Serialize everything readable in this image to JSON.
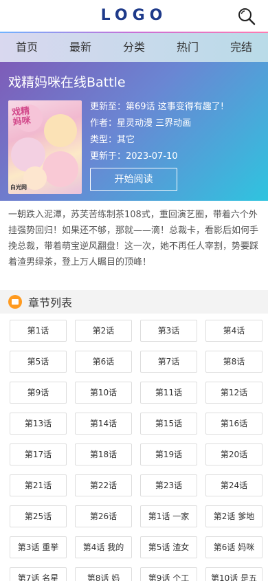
{
  "header": {
    "logo": "LOGO"
  },
  "nav": [
    "首页",
    "最新",
    "分类",
    "热门",
    "完结"
  ],
  "comic": {
    "title": "戏精妈咪在线Battle",
    "update_label": "更新至：",
    "update_value": "第69话 这事变得有趣了!",
    "author_label": "作者：",
    "author_value": "星灵动漫 三界动画",
    "type_label": "类型：",
    "type_value": "其它",
    "date_label": "更新于：",
    "date_value": "2023-07-10",
    "start_label": "开始阅读",
    "cover_logo": "白光网"
  },
  "description": "一朝跌入泥潭，苏芙苦练制茶108式，重回演艺圈，带着六个外挂强势回归！如果还不够，那就——滴！总裁卡，看影后如何手挽总裁，带着萌宝逆风翻盘！这一次，她不再任人宰割，势要踩着渣男绿茶，登上万人瞩目的顶峰！",
  "chapters_title": "章节列表",
  "chapters": [
    "第1话",
    "第2话",
    "第3话",
    "第4话",
    "第5话",
    "第6话",
    "第7话",
    "第8话",
    "第9话",
    "第10话",
    "第11话",
    "第12话",
    "第13话",
    "第14话",
    "第15话",
    "第16话",
    "第17话",
    "第18话",
    "第19话",
    "第20话",
    "第21话",
    "第22话",
    "第23话",
    "第24话",
    "第25话",
    "第26话",
    "第1话 一家",
    "第2话 爹地",
    "第3话 重挙",
    "第4话 我的",
    "第5话 渣女",
    "第6话 妈咪",
    "第7话 名星",
    "第8话 妈",
    "第9话 个工",
    "第10话 是五"
  ]
}
